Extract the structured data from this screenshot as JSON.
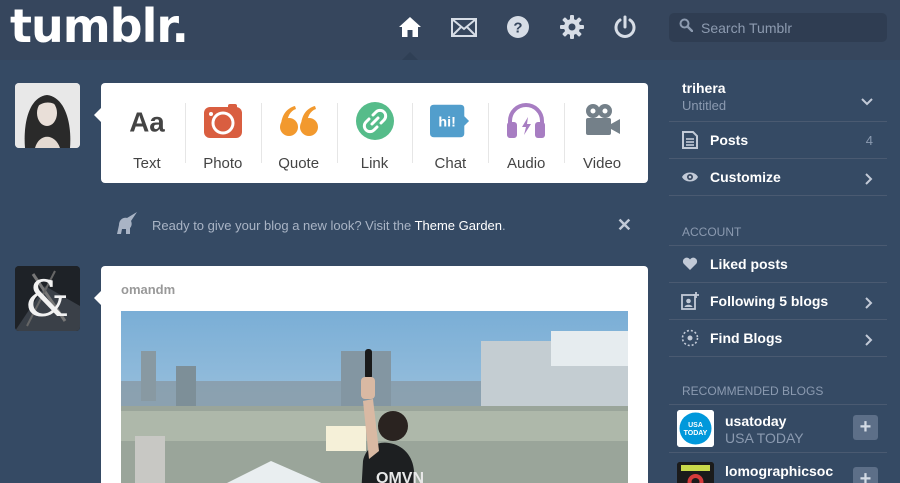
{
  "header": {
    "logo": "tumblr.",
    "nav": [
      {
        "name": "home-icon"
      },
      {
        "name": "mail-icon"
      },
      {
        "name": "help-icon"
      },
      {
        "name": "gear-icon"
      },
      {
        "name": "power-icon"
      }
    ],
    "search_placeholder": "Search Tumblr"
  },
  "post_types": [
    {
      "label": "Text",
      "icon": "text-icon",
      "color": "#444444"
    },
    {
      "label": "Photo",
      "icon": "camera-icon",
      "color": "#d95e40"
    },
    {
      "label": "Quote",
      "icon": "quote-icon",
      "color": "#f2992e"
    },
    {
      "label": "Link",
      "icon": "link-icon",
      "color": "#56bc8a"
    },
    {
      "label": "Chat",
      "icon": "chat-icon",
      "color": "#529ecc"
    },
    {
      "label": "Audio",
      "icon": "headphones-icon",
      "color": "#a77dc2"
    },
    {
      "label": "Video",
      "icon": "video-camera-icon",
      "color": "#748089"
    }
  ],
  "notice": {
    "text": "Ready to give your blog a new look? Visit the ",
    "link": "Theme Garden",
    "suffix": "."
  },
  "post": {
    "author": "omandm"
  },
  "sidebar": {
    "blog_name": "trihera",
    "blog_title": "Untitled",
    "items": [
      {
        "label": "Posts",
        "count": "4",
        "icon": "document-icon"
      },
      {
        "label": "Customize",
        "icon": "eye-icon"
      }
    ],
    "account_title": "ACCOUNT",
    "account_items": [
      {
        "label": "Liked posts",
        "icon": "heart-icon"
      },
      {
        "label": "Following 5 blogs",
        "icon": "following-icon"
      },
      {
        "label": "Find Blogs",
        "icon": "compass-icon"
      }
    ],
    "recommended_title": "RECOMMENDED BLOGS",
    "recommended": [
      {
        "name": "usatoday",
        "title": "USA TODAY",
        "badge": "USA TODAY"
      },
      {
        "name": "lomographicsoc",
        "title": ""
      }
    ]
  }
}
